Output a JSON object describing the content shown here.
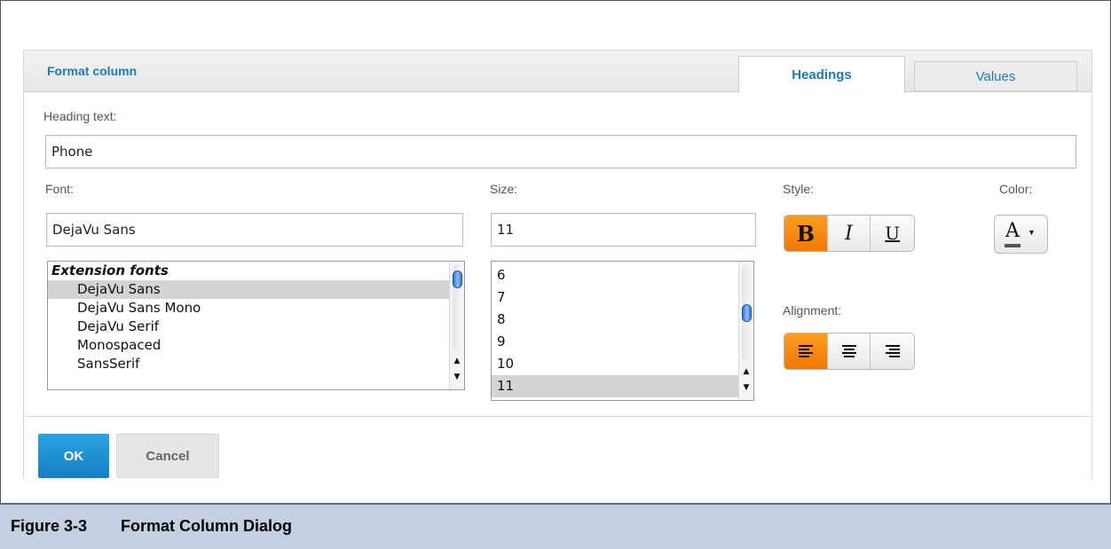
{
  "dialog": {
    "title": "Format column",
    "tabs": [
      {
        "label": "Headings",
        "active": true
      },
      {
        "label": "Values",
        "active": false
      }
    ]
  },
  "heading": {
    "label": "Heading text:",
    "value": "Phone"
  },
  "font": {
    "label": "Font:",
    "value": "DejaVu Sans",
    "list": {
      "group": "Extension fonts",
      "items": [
        "DejaVu Sans",
        "DejaVu Sans Mono",
        "DejaVu Serif",
        "Monospaced",
        "SansSerif"
      ],
      "selected": "DejaVu Sans"
    }
  },
  "size": {
    "label": "Size:",
    "value": "11",
    "list": {
      "items": [
        "6",
        "7",
        "8",
        "9",
        "10",
        "11"
      ],
      "selected": "11"
    }
  },
  "style": {
    "label": "Style:",
    "buttons": [
      {
        "label": "B",
        "icon": "bold-icon",
        "active": true
      },
      {
        "label": "I",
        "icon": "italic-icon",
        "active": false
      },
      {
        "label": "U",
        "icon": "underline-icon",
        "active": false
      }
    ]
  },
  "color": {
    "label": "Color:",
    "icon": "font-color-icon",
    "glyph": "A"
  },
  "alignment": {
    "label": "Alignment:",
    "buttons": [
      {
        "icon": "align-left-icon",
        "active": true
      },
      {
        "icon": "align-center-icon",
        "active": false
      },
      {
        "icon": "align-right-icon",
        "active": false
      }
    ]
  },
  "footer": {
    "ok_label": "OK",
    "cancel_label": "Cancel"
  },
  "caption": {
    "number": "Figure 3-3",
    "title": "Format Column Dialog"
  },
  "colors": {
    "accent_blue": "#1a7bb9",
    "active_orange": "#f07800",
    "ok_button": "#1e8fd3",
    "caption_bg": "#c5cfe2"
  }
}
